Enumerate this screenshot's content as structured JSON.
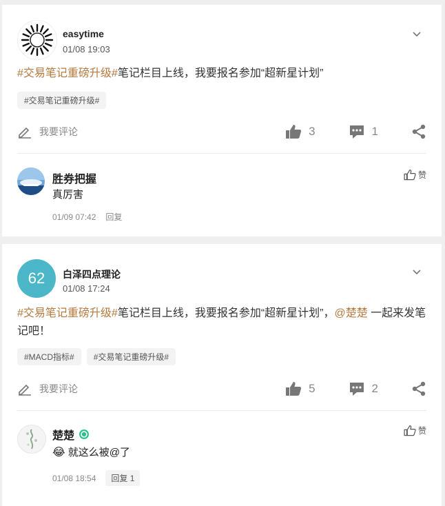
{
  "posts": [
    {
      "author": "easytime",
      "time": "01/08 19:03",
      "content": {
        "hashtag": "#交易笔记重磅升级#",
        "text": "笔记栏目上线，我要报名参加“超新星计划”"
      },
      "tags": [
        "#交易笔记重磅升级#"
      ],
      "comment_placeholder": "我要评论",
      "likes": "3",
      "comments": "1",
      "reply": {
        "name": "胜券把握",
        "text": "真厉害",
        "time": "01/09 07:42",
        "reply_label": "回复",
        "like_label": "赞"
      }
    },
    {
      "author": "白泽四点理论",
      "avatar_text": "62",
      "time": "01/08 17:24",
      "content": {
        "hashtag": "#交易笔记重磅升级#",
        "text": "笔记栏目上线，我要报名参加“超新星计划”，",
        "mention": "@楚楚",
        "text2": " 一起来发笔记吧！"
      },
      "tags": [
        "#MACD指标#",
        "#交易笔记重磅升级#"
      ],
      "comment_placeholder": "我要评论",
      "likes": "5",
      "comments": "2",
      "reply": {
        "name": "楚楚",
        "emoji": "😂",
        "text": "就这么被@了",
        "time": "01/08 18:54",
        "reply_label": "回复 1",
        "like_label": "赞"
      }
    }
  ],
  "colors": {
    "hashtag": "#b5793d",
    "avatar_teal": "#4bb7c8",
    "background": "#efefef"
  }
}
